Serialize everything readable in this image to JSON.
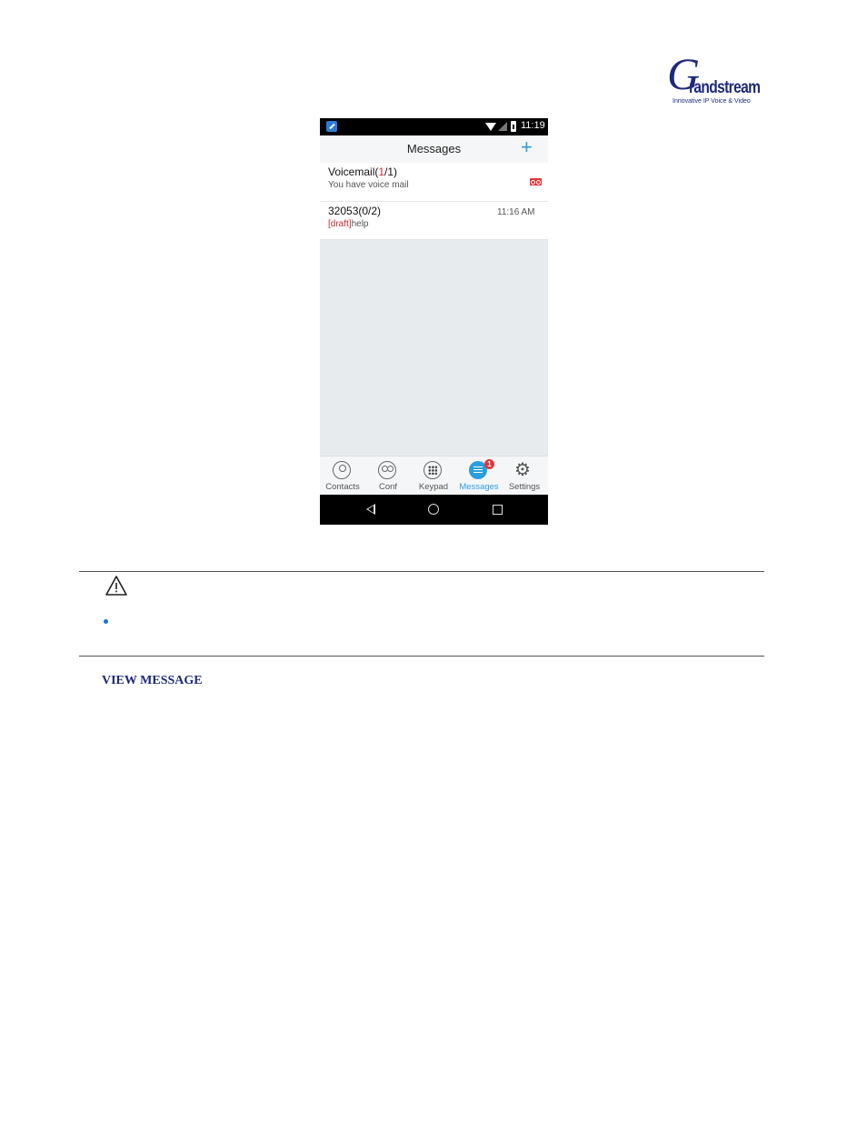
{
  "logo": {
    "initial": "G",
    "brand": "randstream",
    "tagline": "Innovative IP Voice & Video"
  },
  "phone": {
    "status_bar": {
      "time": "11:19",
      "icons": [
        "app-notification-icon",
        "wifi-icon",
        "signal-icon",
        "battery-icon"
      ]
    },
    "header": {
      "title": "Messages",
      "action_icon": "plus-icon"
    },
    "messages": [
      {
        "name_prefix": "Voicemail(",
        "name_highlight": "1",
        "name_suffix": "/1)",
        "subtitle": "You have voice mail",
        "icon": "voicemail-icon"
      },
      {
        "name": "32053(0/2)",
        "draft_tag": "[draft]",
        "preview": "help",
        "time": "11:16 AM"
      }
    ],
    "tabs": [
      {
        "label": "Contacts",
        "icon": "contacts-icon"
      },
      {
        "label": "Conf",
        "icon": "conference-icon"
      },
      {
        "label": "Keypad",
        "icon": "keypad-icon"
      },
      {
        "label": "Messages",
        "icon": "messages-icon",
        "badge": "1",
        "active": true
      },
      {
        "label": "Settings",
        "icon": "settings-gear-icon"
      }
    ],
    "nav_icons": [
      "back-icon",
      "home-icon",
      "recent-apps-icon"
    ]
  },
  "document": {
    "note_icon": "warning-icon",
    "section_heading": "VIEW MESSAGE"
  },
  "colors": {
    "accent": "#2a9ee0",
    "alert": "#e0373a",
    "brand": "#1e2a7a"
  }
}
